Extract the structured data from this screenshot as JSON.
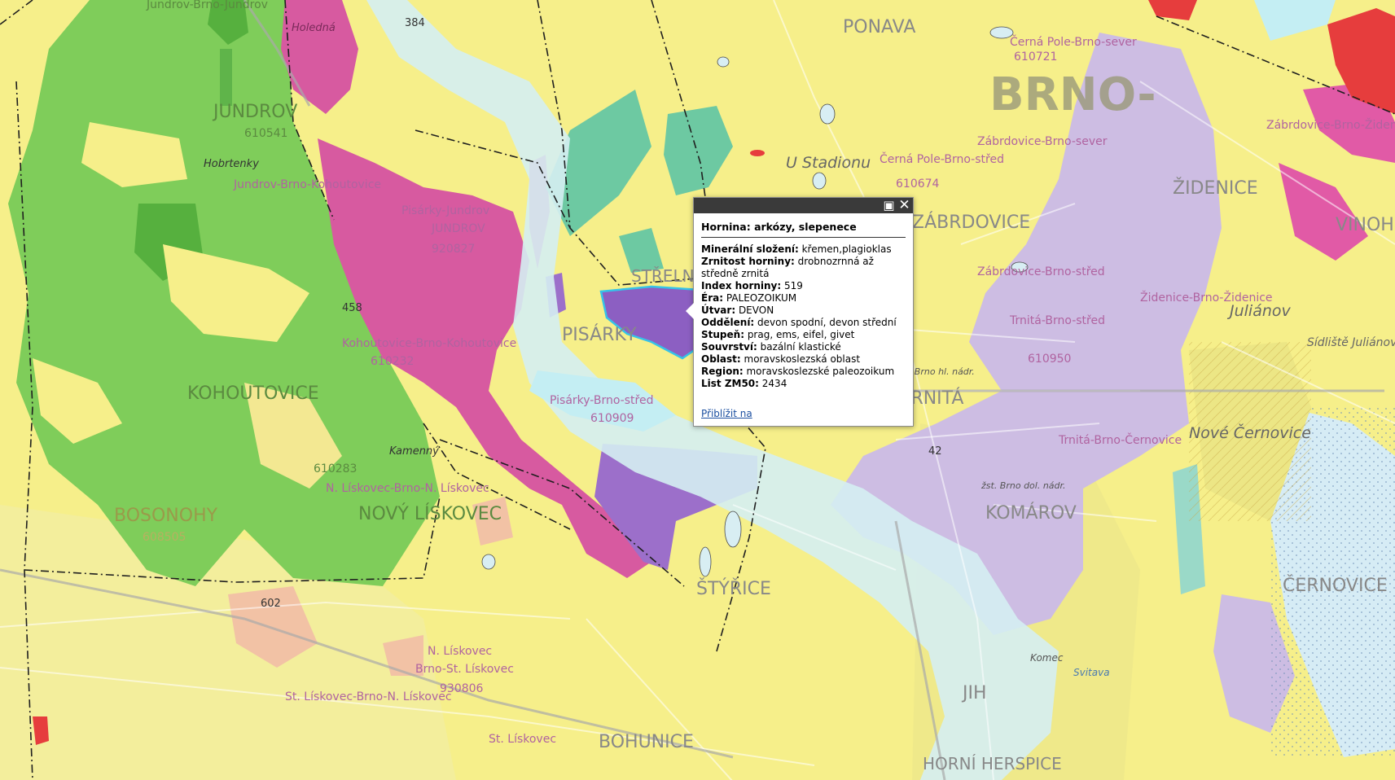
{
  "map": {
    "colors": {
      "yellow": "#f6ef8a",
      "green": "#78c850",
      "magenta": "#d45a9e",
      "purple": "#9b6fc9",
      "lavender": "#cbbbe0",
      "teal": "#66c7a0",
      "aqua": "#c7eef0",
      "peach": "#f2c1a2",
      "red": "#e84040",
      "highlight": "#36c3e8"
    },
    "places": {
      "jundrov_brno_jundrov": "Jundrov-Brno-Jundrov",
      "holedna": "Holedná",
      "jundrov": "JUNDROV",
      "jundrov_code": "610541",
      "hobrtenky": "Hobrtenky",
      "jundrov_brno_kohoutovice": "Jundrov-Brno-Kohoutovice",
      "pisarky_jundrov": "Pisárky-Jundrov",
      "code_920827": "920827",
      "kohoutovice_brno_kohoutovice": "Kohoutovice-Brno-Kohoutovice",
      "code_610232": "610232",
      "kohoutovice": "KOHOUTOVICE",
      "kamenny": "Kamenný",
      "code_610283": "610283",
      "novy_liskovec_brno": "N. Lískovec-Brno-N. Lískovec",
      "nov_liskovec": "NOVÝ LÍSKOVEC",
      "bosonohy": "BOSONOHY",
      "code_608505": "608505",
      "road_602": "602",
      "n_liskovec": "N. Lískovec",
      "brno_st_liskovec": "Brno-St. Lískovec",
      "code_930806": "930806",
      "st_liskovec_brno_n": "St. Lískovec-Brno-N. Lískovec",
      "st_liskovec": "St. Lískovec",
      "ponava": "PONAVA",
      "cerna_pole_sever": "Černá Pole-Brno-sever",
      "code_610721": "610721",
      "brno": "BRNO-",
      "u_stadionu": "U Stadionu",
      "cerna_pole_stred": "Černá Pole-Brno-střed",
      "code_610674": "610674",
      "zabrdovice_sever": "Zábrdovice-Brno-sever",
      "zabrdovice": "ZÁBRDOVICE",
      "zabrdovice_stred": "Zábrdovice-Brno-střed",
      "zabrdovice_zidenice": "Zábrdovice-Brno-Židenice",
      "zidenice": "ŽIDENICE",
      "zidenice_brno": "Židenice-Brno-Židenice",
      "vinohrady": "VINOHRADY",
      "julianov": "Juliánov",
      "sidliste_julianov": "Sídliště Juliánov",
      "trnita_label": "TRNITÁ",
      "trnita_brno_stred": "Trnitá-Brno-střed",
      "code_610950": "610950",
      "zst_brno_hl": "žst. Brno hl. nádr.",
      "zst_brno_dol": "žst. Brno dol. nádr.",
      "komarov": "KOMÁROV",
      "trnita_cernovice": "Trnitá-Brno-Černovice",
      "nove_cernovice": "Nové Černovice",
      "cernovice": "ČERNOVICE",
      "pisarky": "PISÁRKY",
      "strelnice": "STŘELNICE",
      "pisarky_stred": "Pisárky-Brno-střed",
      "code_610909": "610909",
      "styrice": "ŠTÝŘICE",
      "bohunice": "BOHUNICE",
      "jih": "JIH",
      "horni_herspice": "HORNÍ HERSPICE",
      "komec": "Komec",
      "svitava": "Svitava",
      "road_384": "384",
      "road_42": "42",
      "code_458": "458"
    }
  },
  "popup": {
    "maximize_icon": "maximize-icon",
    "close_icon": "close-icon",
    "title": "Hornina: arkózy, slepenece",
    "attributes": [
      {
        "label": "Minerální složení:",
        "value": "křemen,plagioklas"
      },
      {
        "label": "Zrnitost horniny:",
        "value": "drobnozrnná až středně zrnitá"
      },
      {
        "label": "Index horniny:",
        "value": "519"
      },
      {
        "label": "Éra:",
        "value": "PALEOZOIKUM"
      },
      {
        "label": "Útvar:",
        "value": "DEVON"
      },
      {
        "label": "Oddělení:",
        "value": "devon spodní, devon střední"
      },
      {
        "label": "Stupeň:",
        "value": "prag, ems, eifel, givet"
      },
      {
        "label": "Souvrství:",
        "value": "bazální klastické"
      },
      {
        "label": "Oblast:",
        "value": "moravskoslezská oblast"
      },
      {
        "label": "Region:",
        "value": "moravskoslezské paleozoikum"
      },
      {
        "label": "List ZM50:",
        "value": "2434"
      }
    ],
    "zoom_link": "Přiblížit na"
  }
}
